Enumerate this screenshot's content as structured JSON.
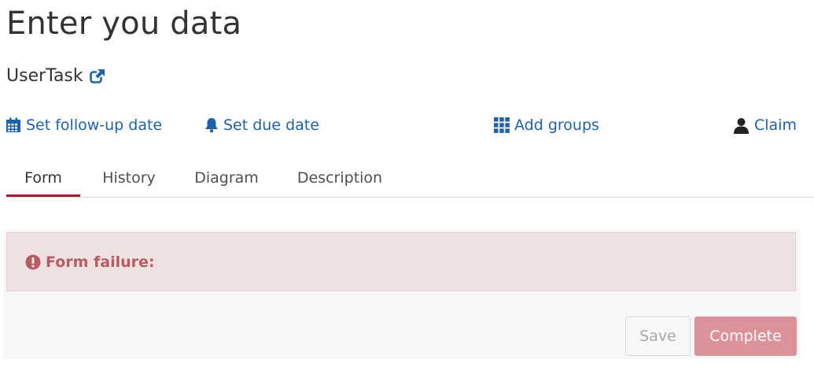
{
  "page": {
    "title": "Enter you data"
  },
  "task": {
    "name": "UserTask",
    "external_link_icon": "external-link-icon"
  },
  "actions": {
    "follow_up": {
      "label": "Set follow-up date",
      "icon": "calendar-icon"
    },
    "due_date": {
      "label": "Set due date",
      "icon": "bell-icon"
    },
    "groups": {
      "label": "Add groups",
      "icon": "grid-icon"
    },
    "claim": {
      "label": "Claim",
      "icon": "user-icon"
    }
  },
  "tabs": [
    {
      "label": "Form",
      "active": true
    },
    {
      "label": "History",
      "active": false
    },
    {
      "label": "Diagram",
      "active": false
    },
    {
      "label": "Description",
      "active": false
    }
  ],
  "form": {
    "alert_text": "Form failure:",
    "alert_icon": "exclamation-circle-icon",
    "save_label": "Save",
    "complete_label": "Complete"
  },
  "colors": {
    "link": "#1f62a8",
    "active_tab_underline": "#a61a2b",
    "alert_bg": "#efe1e2",
    "alert_text": "#b45d63",
    "complete_button": "#db9299"
  }
}
